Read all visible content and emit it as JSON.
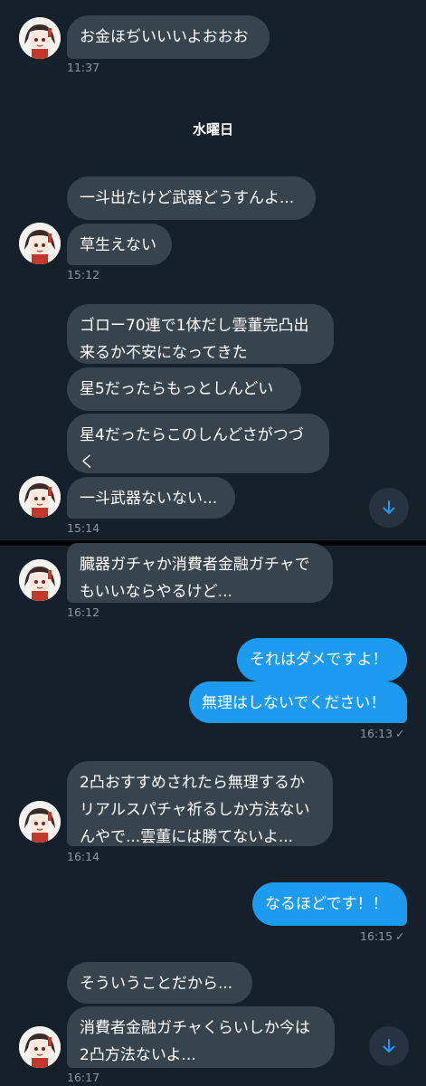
{
  "colors": {
    "background": "#15202b",
    "incoming_bubble": "#38444d",
    "outgoing_bubble": "#1d9bf0",
    "timestamp": "#8b98a5"
  },
  "day_separator": "水曜日",
  "messages": {
    "m1": {
      "text": "お金ほぢいいいよおおお",
      "time": "11:37"
    },
    "m2": {
      "text": "一斗出たけど武器どうすんよ..."
    },
    "m3": {
      "text": "草生えない",
      "time": "15:12"
    },
    "m4": {
      "text": "ゴロー70連で1体だし雲董完凸出\n来るか不安になってきた"
    },
    "m5": {
      "text": "星5だったらもっとしんどい"
    },
    "m6": {
      "text": "星4だったらこのしんどさがつづ\nく"
    },
    "m7": {
      "text": "一斗武器ないない...",
      "time": "15:14"
    },
    "m8": {
      "text": "臓器ガチャか消費者金融ガチャで\nもいいならやるけど...",
      "time": "16:12"
    },
    "m9": {
      "text": "それはダメですよ！"
    },
    "m10": {
      "text": "無理はしないでください！",
      "time": "16:13",
      "read_mark": "✓"
    },
    "m11": {
      "text": "2凸おすすめされたら無理するか\nリアルスパチャ祈るしか方法ない\nんやで...雲董には勝てないよ...",
      "time": "16:14"
    },
    "m12": {
      "text": "なるほどです！！",
      "time": "16:15",
      "read_mark": "✓"
    },
    "m13": {
      "text": "そういうことだから..."
    },
    "m14": {
      "text": "消費者金融ガチャくらいしか今は\n2凸方法ないよ...",
      "time": "16:17"
    }
  },
  "icons": {
    "avatar": "avatar-anime-girl",
    "scroll": "arrow-down-icon"
  }
}
